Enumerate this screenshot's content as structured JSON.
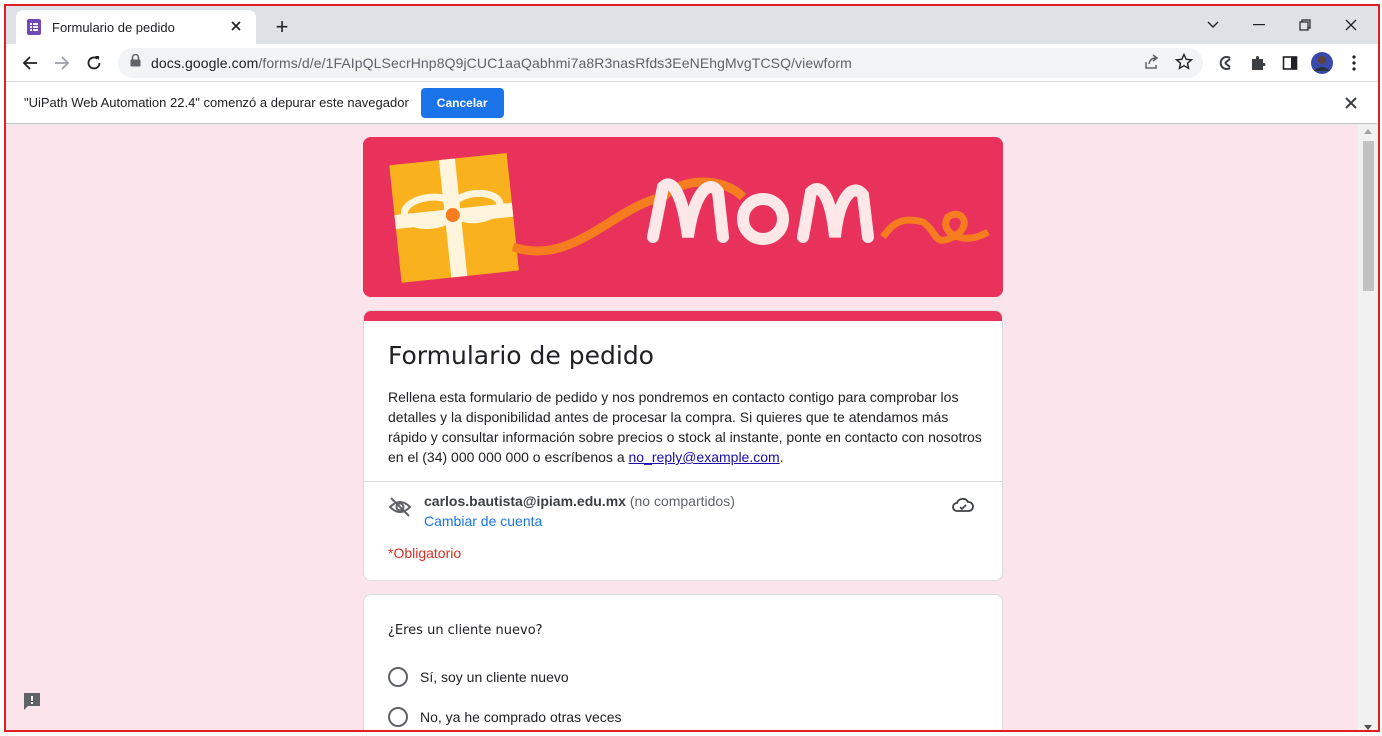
{
  "browser": {
    "tab_title": "Formulario de pedido",
    "new_tab_symbol": "+",
    "url_host": "docs.google.com",
    "url_path": "/forms/d/e/1FAIpQLSecrHnp8Q9jCUC1aaQabhmi7a8R3nasRfds3EeNEhgMvgTCSQ/viewform"
  },
  "infobar": {
    "message": "\"UiPath Web Automation 22.4\" comenzó a depurar este navegador",
    "cancel_label": "Cancelar"
  },
  "form": {
    "title": "Formulario de pedido",
    "description_main": "Rellena esta formulario de pedido y nos pondremos en contacto contigo para comprobar los detalles y la disponibilidad antes de procesar la compra. Si quieres que te atendamos más rápido y consultar información sobre precios o stock al instante, ponte en contacto con nosotros en el (34) 000 000 000 o escríbenos a ",
    "description_email": "no_reply@example.com",
    "description_end": ".",
    "account_email": "carlos.bautista@ipiam.edu.mx",
    "account_note": " (no compartidos)",
    "switch_account": "Cambiar de cuenta",
    "required_note": "*Obligatorio"
  },
  "question": {
    "title": "¿Eres un cliente nuevo?",
    "options": [
      "Sí, soy un cliente nuevo",
      "No, ya he comprado otras veces"
    ]
  },
  "colors": {
    "theme": "#e8315b",
    "background": "#fce4ec",
    "accent": "#1a73e8"
  }
}
